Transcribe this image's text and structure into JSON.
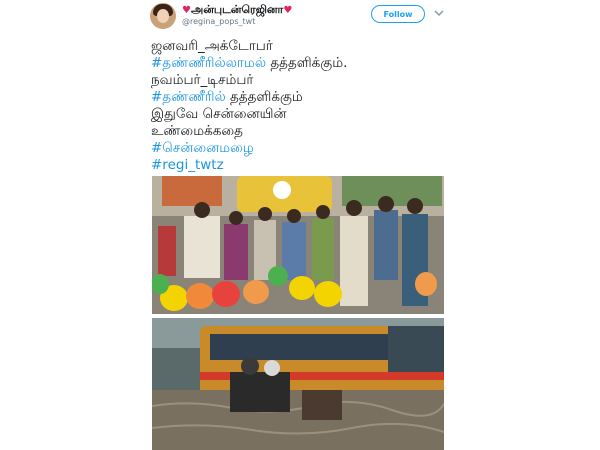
{
  "author": {
    "display_name": "அன்புடன்ரெஜினா",
    "handle": "@regina_pops_twt",
    "follow_label": "Follow",
    "decoration_icon": "heart-icon"
  },
  "tweet": {
    "lines": [
      {
        "pre": "ஜனவரி_அக்டோபர்",
        "tag": "",
        "post": ""
      },
      {
        "pre": "",
        "tag": "#தண்ணீரில்லாமல்",
        "post": " தத்தளிக்கும்."
      },
      {
        "pre": "நவம்பர்_டிசம்பர்",
        "tag": "",
        "post": ""
      },
      {
        "pre": "",
        "tag": "#தண்ணீரில்",
        "post": " தத்தளிக்கும்"
      },
      {
        "pre": "இதுவே சென்னையின்",
        "tag": "",
        "post": ""
      },
      {
        "pre": "உண்மைக்கதை",
        "tag": "",
        "post": ""
      },
      {
        "pre": "",
        "tag": "#சென்னைமழை",
        "post": ""
      },
      {
        "pre": "",
        "tag": "#regi_twtz",
        "post": ""
      }
    ]
  },
  "colors": {
    "hashtag": "#1b95e0",
    "follow_accent": "#1da1f2",
    "heart": "#e0245e"
  }
}
